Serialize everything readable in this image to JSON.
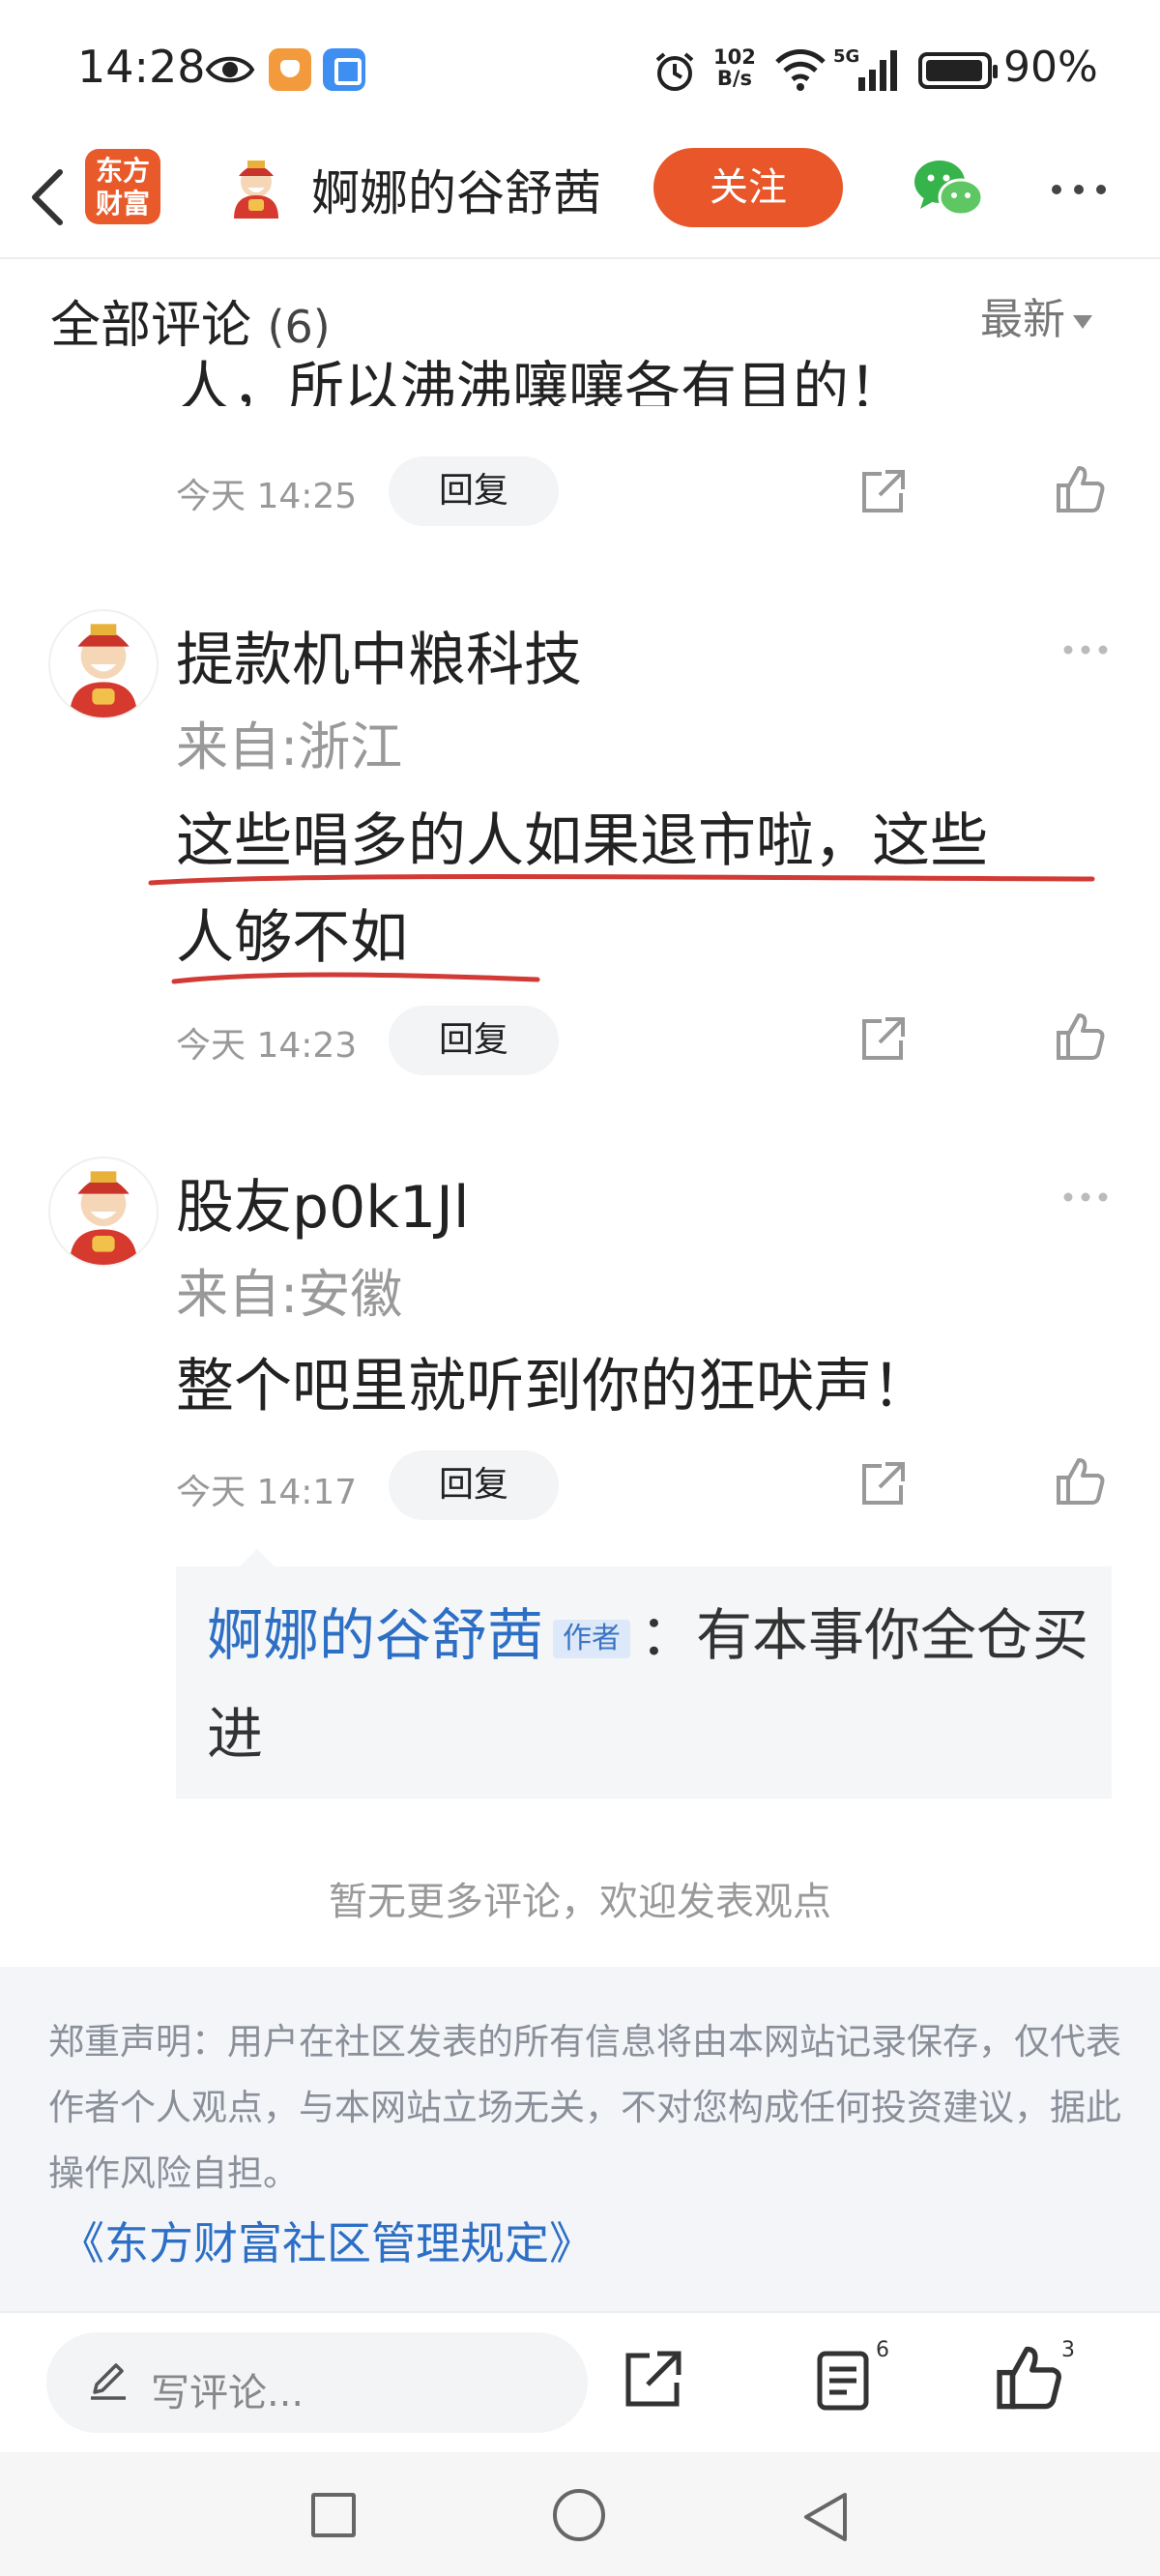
{
  "status_bar": {
    "time": "14:28",
    "net_speed_value": "102",
    "net_speed_unit": "B/s",
    "network": "5G",
    "battery": "90%"
  },
  "header": {
    "logo_line1": "东方",
    "logo_line2": "财富",
    "title": "婀娜的谷舒茜",
    "follow_label": "关注"
  },
  "comments_section": {
    "title": "全部评论",
    "count": "(6)",
    "sort_label": "最新",
    "partial_text": "人，所以沸沸嚷嚷各有目的！",
    "partial_time": "今天 14:25",
    "reply_label": "回复"
  },
  "comments": [
    {
      "user": "提款机中粮科技",
      "location": "来自:浙江",
      "line1": "这些唱多的人如果退市啦，这些",
      "line2": "人够不如",
      "time": "今天 14:23"
    },
    {
      "user": "股友p0k1Jl",
      "location": "来自:安徽",
      "line1": "整个吧里就听到你的狂吠声！",
      "time": "今天 14:17",
      "reply": {
        "author": "婀娜的谷舒茜",
        "badge": "作者",
        "text": "：有本事你全仓买进"
      }
    }
  ],
  "no_more_text": "暂无更多评论，欢迎发表观点",
  "disclaimer": {
    "text": "郑重声明：用户在社区发表的所有信息将由本网站记录保存，仅代表作者个人观点，与本网站立场无关，不对您构成任何投资建议，据此操作风险自担。",
    "link": "《东方财富社区管理规定》"
  },
  "bottom_bar": {
    "placeholder": "写评论...",
    "comment_count": "6",
    "like_count": "3"
  },
  "colors": {
    "brand_orange": "#e8562a",
    "link_blue": "#2d6fc5",
    "underline_red": "#d23a35"
  }
}
